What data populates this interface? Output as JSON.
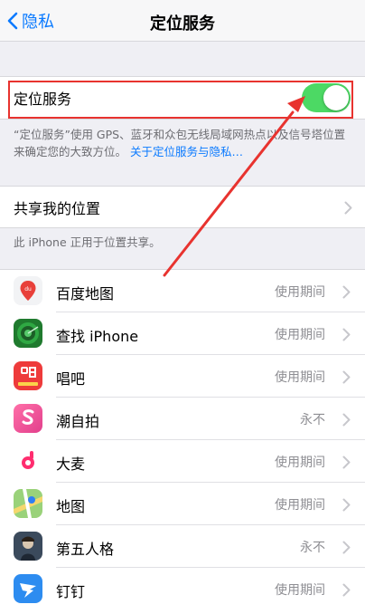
{
  "nav": {
    "back_label": "隐私",
    "title": "定位服务"
  },
  "location_services": {
    "label": "定位服务",
    "enabled": true,
    "description": "“定位服务”使用 GPS、蓝牙和众包无线局域网热点以及信号塔位置来确定您的大致方位。",
    "link_text": "关于定位服务与隐私…"
  },
  "share_location": {
    "label": "共享我的位置",
    "note": "此 iPhone 正用于位置共享。"
  },
  "apps": [
    {
      "name": "百度地图",
      "status": "使用期间",
      "icon": "baidu-map-icon"
    },
    {
      "name": "查找 iPhone",
      "status": "使用期间",
      "icon": "find-iphone-icon"
    },
    {
      "name": "唱吧",
      "status": "使用期间",
      "icon": "changba-icon"
    },
    {
      "name": "潮自拍",
      "status": "永不",
      "icon": "chaozipai-icon"
    },
    {
      "name": "大麦",
      "status": "使用期间",
      "icon": "damai-icon"
    },
    {
      "name": "地图",
      "status": "使用期间",
      "icon": "maps-icon"
    },
    {
      "name": "第五人格",
      "status": "永不",
      "icon": "identity-v-icon"
    },
    {
      "name": "钉钉",
      "status": "使用期间",
      "icon": "dingtalk-icon"
    }
  ],
  "colors": {
    "ios_blue": "#0a7aff",
    "toggle_on": "#4cd964",
    "annotation_red": "#e8332f"
  }
}
